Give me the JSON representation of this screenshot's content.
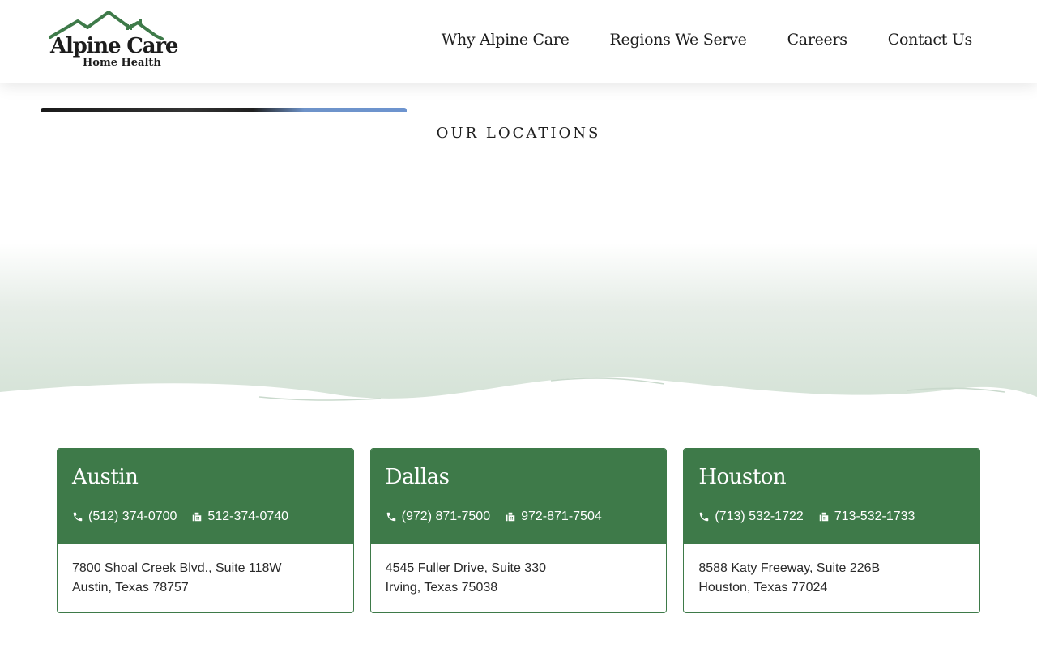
{
  "brand": {
    "name": "Alpine Care",
    "tagline": "Home Health",
    "logo_icon": "mountain-house-icon",
    "accent_color": "#3e7a49"
  },
  "nav": {
    "items": [
      {
        "label": "Why Alpine Care"
      },
      {
        "label": "Regions We Serve"
      },
      {
        "label": "Careers"
      },
      {
        "label": "Contact Us"
      }
    ]
  },
  "section": {
    "eyebrow": "OUR LOCATIONS"
  },
  "locations": [
    {
      "city": "Austin",
      "phone": "(512) 374-0700",
      "fax": "512-374-0740",
      "address_line1": "7800 Shoal Creek Blvd., Suite 118W",
      "address_line2": "Austin, Texas 78757"
    },
    {
      "city": "Dallas",
      "phone": "(972) 871-7500",
      "fax": "972-871-7504",
      "address_line1": "4545 Fuller Drive, Suite 330",
      "address_line2": "Irving, Texas 75038"
    },
    {
      "city": "Houston",
      "phone": "(713) 532-1722",
      "fax": "713-532-1733",
      "address_line1": "8588 Katy Freeway, Suite 226B",
      "address_line2": "Houston, Texas 77024"
    }
  ],
  "icons": {
    "phone": "phone-icon",
    "fax": "fax-icon"
  }
}
